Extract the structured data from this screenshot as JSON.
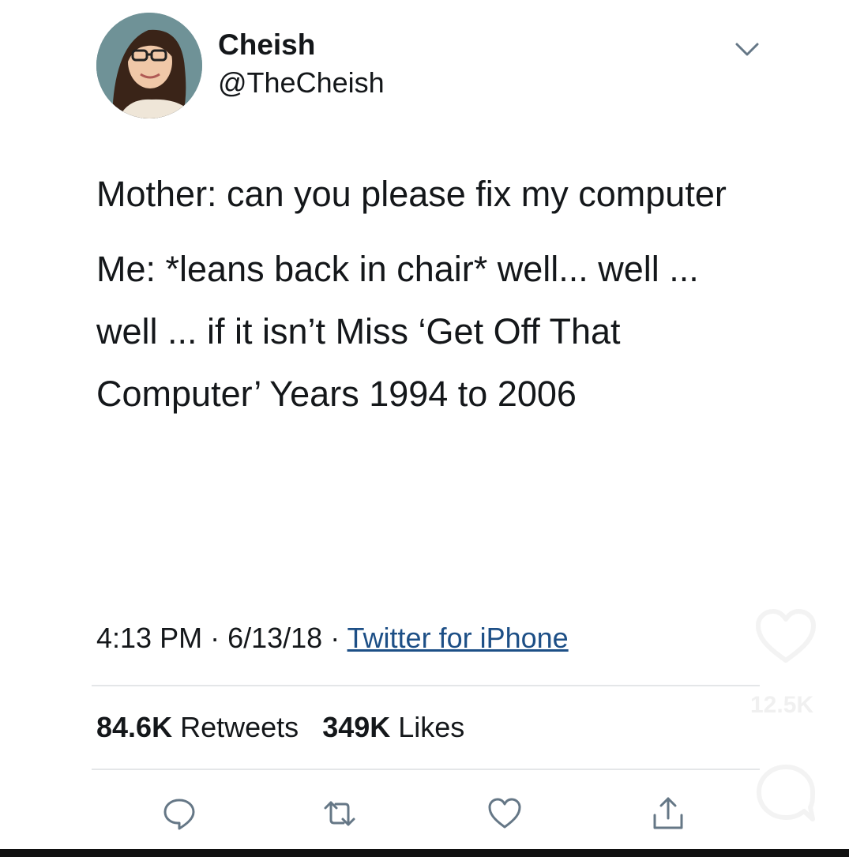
{
  "author": {
    "display_name": "Cheish",
    "handle": "@TheCheish",
    "avatar_icon": "profile-photo"
  },
  "tweet": {
    "paragraphs": [
      "Mother: can you please fix my computer",
      "Me: *leans back in chair* well... well ... well ... if it isn’t Miss ‘Get Off That Computer’ Years 1994 to 2006"
    ],
    "time": "4:13 PM",
    "date": "6/13/18",
    "separator": " · ",
    "source": "Twitter for iPhone"
  },
  "stats": {
    "retweets_count": "84.6K",
    "retweets_label": "Retweets",
    "likes_count": "349K",
    "likes_label": "Likes"
  },
  "actions": [
    "reply-icon",
    "retweet-icon",
    "like-icon",
    "share-icon"
  ],
  "overlay": {
    "like_count": "12.5K"
  },
  "colors": {
    "text": "#14171a",
    "link": "#1d4f86",
    "divider": "#e4e6e8"
  }
}
